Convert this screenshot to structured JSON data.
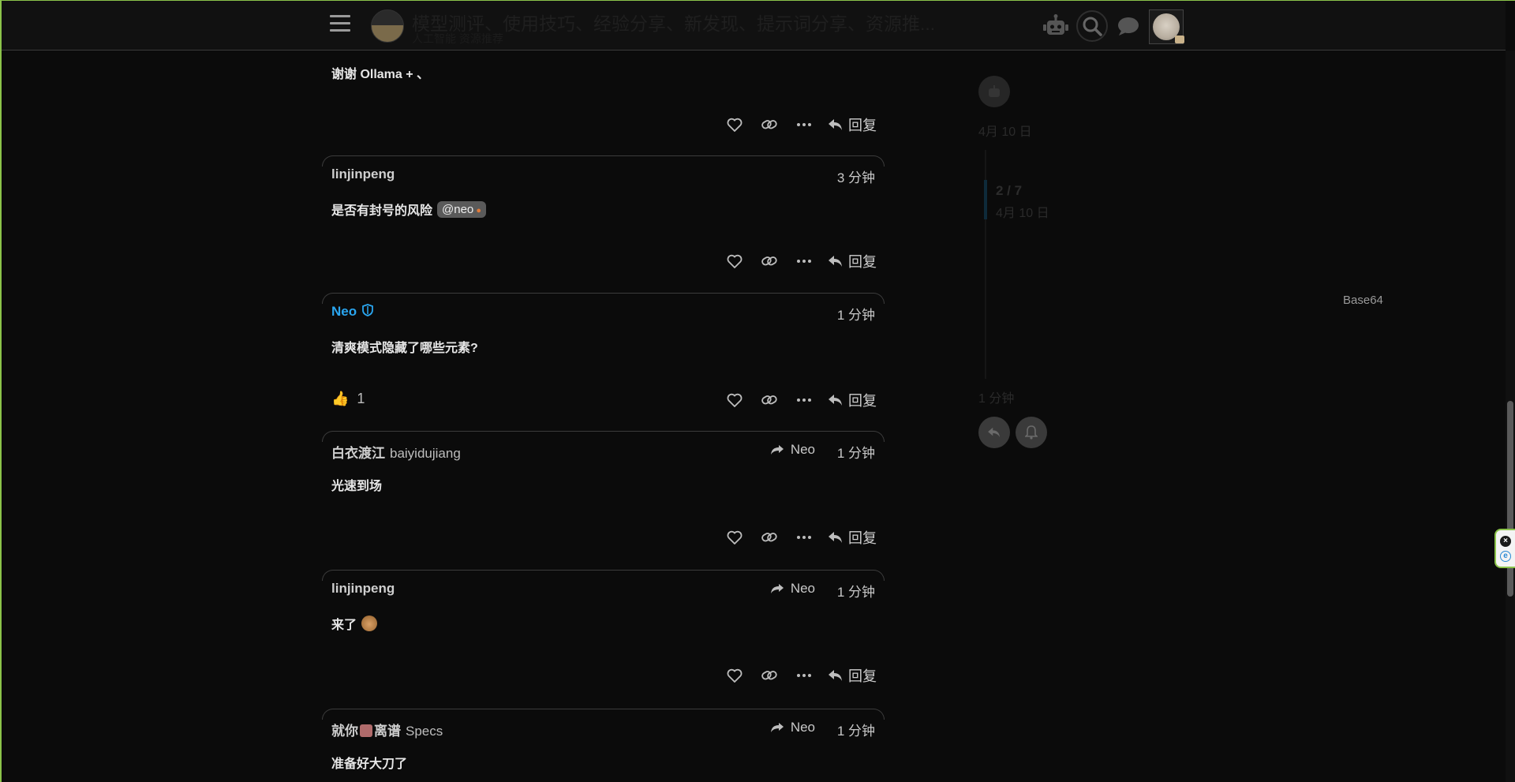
{
  "header": {
    "title": "模型测评、使用技巧、经验分享、新发现、提示词分享、资源推...",
    "subtitle": "人工智能 资源推荐",
    "menu_icon": "hamburger-icon",
    "icons": [
      "robot-icon",
      "search-icon",
      "chat-icon"
    ]
  },
  "posts": [
    {
      "body": "谢谢 Ollama + 、",
      "reply_label": "回复"
    },
    {
      "author": "linjinpeng",
      "time": "3 分钟",
      "body": "是否有封号的风险",
      "mention": "@neo",
      "reply_label": "回复"
    },
    {
      "author": "Neo",
      "time": "1 分钟",
      "body": "清爽模式隐藏了哪些元素?",
      "reaction_count": "1",
      "reply_label": "回复"
    },
    {
      "author": "白衣渡江",
      "username": "baiyidujiang",
      "reply_to": "Neo",
      "time": "1 分钟",
      "body": "光速到场",
      "reply_label": "回复"
    },
    {
      "author": "linjinpeng",
      "reply_to": "Neo",
      "time": "1 分钟",
      "body": "来了",
      "reply_label": "回复"
    },
    {
      "author_part1": "就你",
      "author_part2": "离谱",
      "username": "Specs",
      "reply_to": "Neo",
      "time": "1 分钟",
      "body": "准备好大刀了"
    }
  ],
  "timeline": {
    "date_top": "4月 10 日",
    "position": "2 / 7",
    "position_date": "4月 10 日",
    "date_bottom": "1 分钟"
  },
  "side_label": "Base64",
  "colors": {
    "accent_staff": "#2aa6f0",
    "frame_green": "#8bc34a",
    "background": "#0b0b0b"
  }
}
